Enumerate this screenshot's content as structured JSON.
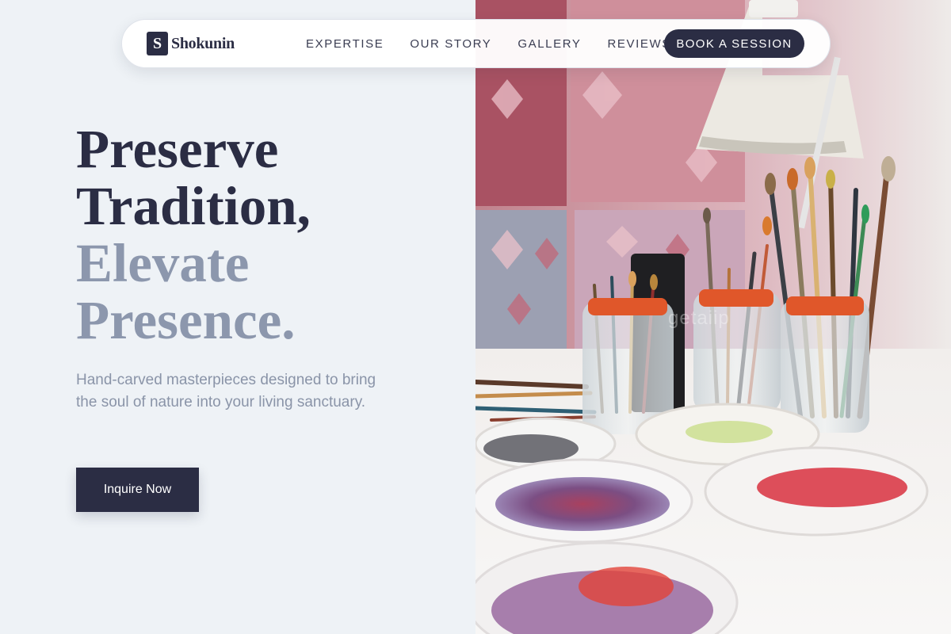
{
  "brand": {
    "mark": "S",
    "name": "Shokunin"
  },
  "nav": {
    "links": [
      "EXPERTISE",
      "OUR STORY",
      "GALLERY",
      "REVIEWS"
    ],
    "cta": "BOOK A SESSION"
  },
  "hero": {
    "headline_dark": [
      "Preserve",
      "Tradition,"
    ],
    "headline_muted": [
      "Elevate",
      "Presence."
    ],
    "subtext": "Hand-carved masterpieces designed to bring the soul of nature into your living sanctuary.",
    "cta": "Inquire Now"
  },
  "photo": {
    "watermark": "getaiip"
  },
  "colors": {
    "primary": "#2b2d44",
    "muted": "#8c97ad",
    "background": "#eef2f6"
  }
}
